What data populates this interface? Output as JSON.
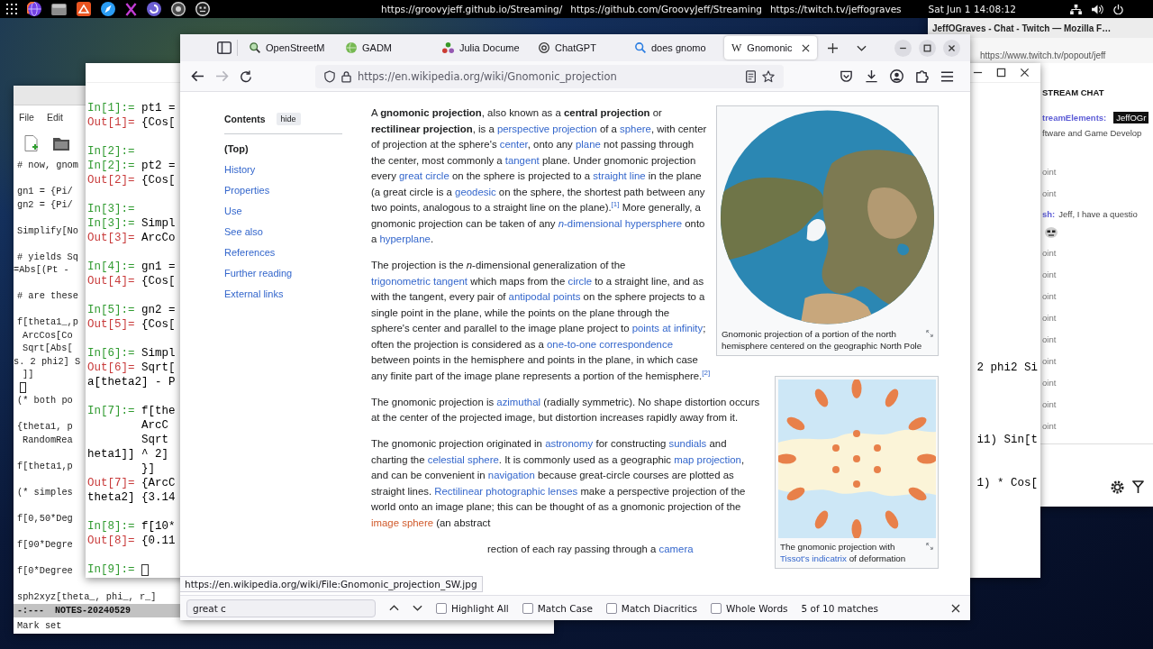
{
  "top_bar": {
    "links": [
      "https://groovyjeff.github.io/Streaming/",
      "https://github.com/GroovyJeff/Streaming",
      "https://twitch.tv/jeffograves"
    ],
    "clock": "Sat Jun 1 14:08:12"
  },
  "emacs": {
    "menu": [
      "File",
      "Edit"
    ],
    "blocks": [
      [
        {
          "kind": "code",
          "text": "# now, gnom"
        }
      ],
      [
        {
          "kind": "code",
          "text": "gn1 = {Pi/"
        },
        {
          "kind": "code",
          "text": "gn2 = {Pi/"
        }
      ],
      [
        {
          "kind": "code",
          "text": "Simplify[No"
        }
      ],
      [
        {
          "kind": "code",
          "text": "# yields Sq"
        },
        {
          "kind": "wrap",
          "text": "=Abs[(Pt -"
        }
      ],
      [
        {
          "kind": "code",
          "text": "# are these"
        }
      ],
      [
        {
          "kind": "code",
          "text": "f[theta1_,p"
        },
        {
          "kind": "indent",
          "text": "ArcCos[Co"
        },
        {
          "kind": "indent",
          "text": "Sqrt[Abs["
        },
        {
          "kind": "wrap",
          "text": "s. 2 phi2] S"
        },
        {
          "kind": "indent",
          "text": "]]"
        },
        {
          "kind": "cursor"
        },
        {
          "kind": "code",
          "text": "(* both po"
        }
      ],
      [
        {
          "kind": "code",
          "text": "{theta1, p"
        },
        {
          "kind": "indent",
          "text": "RandomRea"
        }
      ],
      [
        {
          "kind": "code",
          "text": "f[theta1,p"
        }
      ],
      [
        {
          "kind": "code",
          "text": "(* simples"
        }
      ],
      [
        {
          "kind": "code",
          "text": "f[0,50*Deg"
        }
      ],
      [
        {
          "kind": "code",
          "text": "f[90*Degre"
        }
      ],
      [
        {
          "kind": "code",
          "text": "f[0*Degree"
        }
      ],
      [
        {
          "kind": "code",
          "text": "sph2xyz[theta_, phi_, r_]"
        }
      ]
    ],
    "mode_line": "-:---  NOTES-20240529",
    "echo": "Mark set"
  },
  "twitch": {
    "title": "JeffOGraves - Chat - Twitch — Mozilla F…",
    "url": "https://www.twitch.tv/popout/jeff",
    "heading": "STREAM CHAT",
    "messages": [
      {
        "kind": "announcement",
        "user": "treamElements:",
        "badge": "JeffOGr",
        "text": "ftware and Game Develop"
      },
      {
        "kind": "notice",
        "text": "oint"
      },
      {
        "kind": "notice",
        "text": "oint"
      },
      {
        "kind": "chat",
        "user": "sh:",
        "text": "Jeff, I have a questio"
      },
      {
        "kind": "notice",
        "text": "oint"
      },
      {
        "kind": "notice",
        "text": "oint"
      },
      {
        "kind": "notice",
        "text": "oint"
      },
      {
        "kind": "notice",
        "text": "oint"
      },
      {
        "kind": "notice",
        "text": "oint"
      },
      {
        "kind": "notice",
        "text": "oint"
      },
      {
        "kind": "notice",
        "text": "oint"
      },
      {
        "kind": "notice",
        "text": "oint"
      },
      {
        "kind": "notice",
        "text": "oint"
      }
    ]
  },
  "mathematica": {
    "groups": [
      [
        {
          "kind": "in",
          "label": "In[1]:=",
          "text": "pt1 ="
        },
        {
          "kind": "out",
          "label": "Out[1]=",
          "text": "{Cos["
        }
      ],
      [
        {
          "kind": "in",
          "label": "In[2]:="
        },
        {
          "kind": "in",
          "label": "In[2]:=",
          "text": "pt2 ="
        },
        {
          "kind": "out",
          "label": "Out[2]=",
          "text": "{Cos["
        }
      ],
      [
        {
          "kind": "in",
          "label": "In[3]:="
        },
        {
          "kind": "in",
          "label": "In[3]:=",
          "text": "Simpl"
        },
        {
          "kind": "out",
          "label": "Out[3]=",
          "text": "ArcCo"
        }
      ],
      [
        {
          "kind": "in",
          "label": "In[4]:=",
          "text": "gn1 ="
        },
        {
          "kind": "out",
          "label": "Out[4]=",
          "text": "{Cos["
        }
      ],
      [
        {
          "kind": "in",
          "label": "In[5]:=",
          "text": "gn2 ="
        },
        {
          "kind": "out",
          "label": "Out[5]=",
          "text": "{Cos["
        }
      ],
      [
        {
          "kind": "in",
          "label": "In[6]:=",
          "text": "Simpl"
        },
        {
          "kind": "out",
          "label": "Out[6]=",
          "text": "Sqrt[",
          "tail": "2 phi2 Si"
        },
        {
          "kind": "wrap",
          "text": "a[theta2] - P"
        }
      ],
      [
        {
          "kind": "in",
          "label": "In[7]:=",
          "text": "f[the"
        },
        {
          "kind": "cont",
          "text": "ArcC"
        },
        {
          "kind": "cont",
          "text": "Sqrt",
          "tail": "i1) Sin[t"
        },
        {
          "kind": "wrap",
          "text": "heta1]] ^ 2]"
        },
        {
          "kind": "cont",
          "text": "}]"
        },
        {
          "kind": "out",
          "label": "Out[7]=",
          "text": "{ArcC",
          "tail": "1) * Cos["
        },
        {
          "kind": "wrap",
          "text": "theta2] {3.14"
        }
      ],
      [
        {
          "kind": "in",
          "label": "In[8]:=",
          "text": "f[10*"
        },
        {
          "kind": "out",
          "label": "Out[8]=",
          "text": "{0.11"
        }
      ],
      [
        {
          "kind": "prompt",
          "label": "In[9]:="
        }
      ]
    ]
  },
  "browser": {
    "tabs": [
      {
        "kind": "map",
        "title": "OpenStreetM",
        "selected": false
      },
      {
        "kind": "globe",
        "title": "GADM",
        "selected": false
      },
      {
        "kind": "dots",
        "title": "Julia Docume",
        "selected": false
      },
      {
        "kind": "knot",
        "title": "ChatGPT",
        "selected": false
      },
      {
        "kind": "search",
        "title": "does gnomo",
        "selected": false
      },
      {
        "kind": "letter",
        "glyph": "W",
        "title": "Gnomonic",
        "selected": true
      }
    ],
    "back": {
      "disabled": false
    },
    "forward": {
      "disabled": true
    },
    "url": "https://en.wikipedia.org/wiki/Gnomonic_projection",
    "toc": {
      "title": "Contents",
      "toggle": "hide",
      "items": [
        {
          "label": "(Top)",
          "selected": true
        },
        {
          "label": "History",
          "selected": false
        },
        {
          "label": "Properties",
          "selected": false
        },
        {
          "label": "Use",
          "selected": false
        },
        {
          "label": "See also",
          "selected": false
        },
        {
          "label": "References",
          "selected": false
        },
        {
          "label": "Further reading",
          "selected": false
        },
        {
          "label": "External links",
          "selected": false
        }
      ]
    },
    "figures": [
      {
        "kind": "polar_map",
        "caption": [
          {
            "kind": "text",
            "text": "Gnomonic projection of a portion of the north hemisphere centered on the geographic North Pole"
          }
        ]
      },
      {
        "kind": "tissot_map",
        "caption": [
          {
            "kind": "text",
            "text": "The gnomonic projection with "
          },
          {
            "kind": "link",
            "text": "Tissot's indicatrix"
          },
          {
            "kind": "text",
            "text": " of deformation"
          }
        ]
      }
    ],
    "paragraphs": [
      [
        {
          "kind": "text",
          "text": "A **gnomonic projection**, also known as a **central projection** or **rectilinear projection**, is a "
        },
        {
          "kind": "link",
          "text": "perspective projection"
        },
        {
          "kind": "text",
          "text": " of a "
        },
        {
          "kind": "link",
          "text": "sphere"
        },
        {
          "kind": "text",
          "text": ", with center of projection at the sphere's "
        },
        {
          "kind": "link",
          "text": "center"
        },
        {
          "kind": "text",
          "text": ", onto any "
        },
        {
          "kind": "link",
          "text": "plane"
        },
        {
          "kind": "text",
          "text": " not passing through the center, most commonly a "
        },
        {
          "kind": "link",
          "text": "tangent"
        },
        {
          "kind": "text",
          "text": " plane. Under gnomonic projection every "
        },
        {
          "kind": "link",
          "text": "great circle"
        },
        {
          "kind": "text",
          "text": " on the sphere is projected to a "
        },
        {
          "kind": "link",
          "text": "straight line"
        },
        {
          "kind": "text",
          "text": " in the plane (a great circle is a "
        },
        {
          "kind": "link",
          "text": "geodesic"
        },
        {
          "kind": "text",
          "text": " on the sphere, the shortest path between any two points, analogous to a straight line on the plane)."
        },
        {
          "kind": "ref",
          "text": "[1]"
        },
        {
          "kind": "text",
          "text": " More generally, a gnomonic projection can be taken of any "
        },
        {
          "kind": "link",
          "text": "*n*-dimensional hypersphere"
        },
        {
          "kind": "text",
          "text": " onto a "
        },
        {
          "kind": "link",
          "text": "hyperplane"
        },
        {
          "kind": "text",
          "text": "."
        }
      ],
      [
        {
          "kind": "text",
          "text": "The projection is the *n*-dimensional generalization of the "
        },
        {
          "kind": "link",
          "text": "trigonometric tangent"
        },
        {
          "kind": "text",
          "text": " which maps from the "
        },
        {
          "kind": "link",
          "text": "circle"
        },
        {
          "kind": "text",
          "text": " to a straight line, and as with the tangent, every pair of "
        },
        {
          "kind": "link",
          "text": "antipodal points"
        },
        {
          "kind": "text",
          "text": " on the sphere projects to a single point in the plane, while the points on the plane through the sphere's center and parallel to the image plane project to "
        },
        {
          "kind": "link",
          "text": "points at infinity"
        },
        {
          "kind": "text",
          "text": "; often the projection is considered as a "
        },
        {
          "kind": "link",
          "text": "one-to-one correspondence"
        },
        {
          "kind": "text",
          "text": " between points in the hemisphere and points in the plane, in which case any finite part of the image plane represents a portion of the hemisphere."
        },
        {
          "kind": "ref",
          "text": "[2]"
        }
      ],
      [
        {
          "kind": "text",
          "text": "The gnomonic projection is "
        },
        {
          "kind": "link",
          "text": "azimuthal"
        },
        {
          "kind": "text",
          "text": " (radially symmetric). No shape distortion occurs at the center of the projected image, but distortion increases rapidly away from it."
        }
      ],
      [
        {
          "kind": "text",
          "text": "The gnomonic projection originated in "
        },
        {
          "kind": "link",
          "text": "astronomy"
        },
        {
          "kind": "text",
          "text": " for constructing "
        },
        {
          "kind": "link",
          "text": "sundials"
        },
        {
          "kind": "text",
          "text": " and charting the "
        },
        {
          "kind": "link",
          "text": "celestial sphere"
        },
        {
          "kind": "text",
          "text": ". It is commonly used as a geographic "
        },
        {
          "kind": "link",
          "text": "map projection"
        },
        {
          "kind": "text",
          "text": ", and can be convenient in "
        },
        {
          "kind": "link",
          "text": "navigation"
        },
        {
          "kind": "text",
          "text": " because great-circle courses are plotted as straight lines. "
        },
        {
          "kind": "link",
          "text": "Rectilinear photographic lenses"
        },
        {
          "kind": "text",
          "text": " make a perspective projection of the world onto an image plane; this can be thought of as a gnomonic projection of the "
        },
        {
          "kind": "new",
          "text": "image sphere"
        },
        {
          "kind": "text",
          "text": " (an abstract"
        }
      ]
    ],
    "cut_line": [
      {
        "kind": "text",
        "text": "rection of each ray passing through a "
      },
      {
        "kind": "link",
        "text": "camera"
      }
    ],
    "status": "https://en.wikipedia.org/wiki/File:Gnomonic_projection_SW.jpg",
    "find": {
      "value": "great c",
      "options": [
        {
          "label": "Highlight All",
          "checked": false
        },
        {
          "label": "Match Case",
          "checked": false
        },
        {
          "label": "Match Diacritics",
          "checked": false
        },
        {
          "label": "Whole Words",
          "checked": false
        }
      ],
      "result": "5 of 10 matches"
    }
  }
}
